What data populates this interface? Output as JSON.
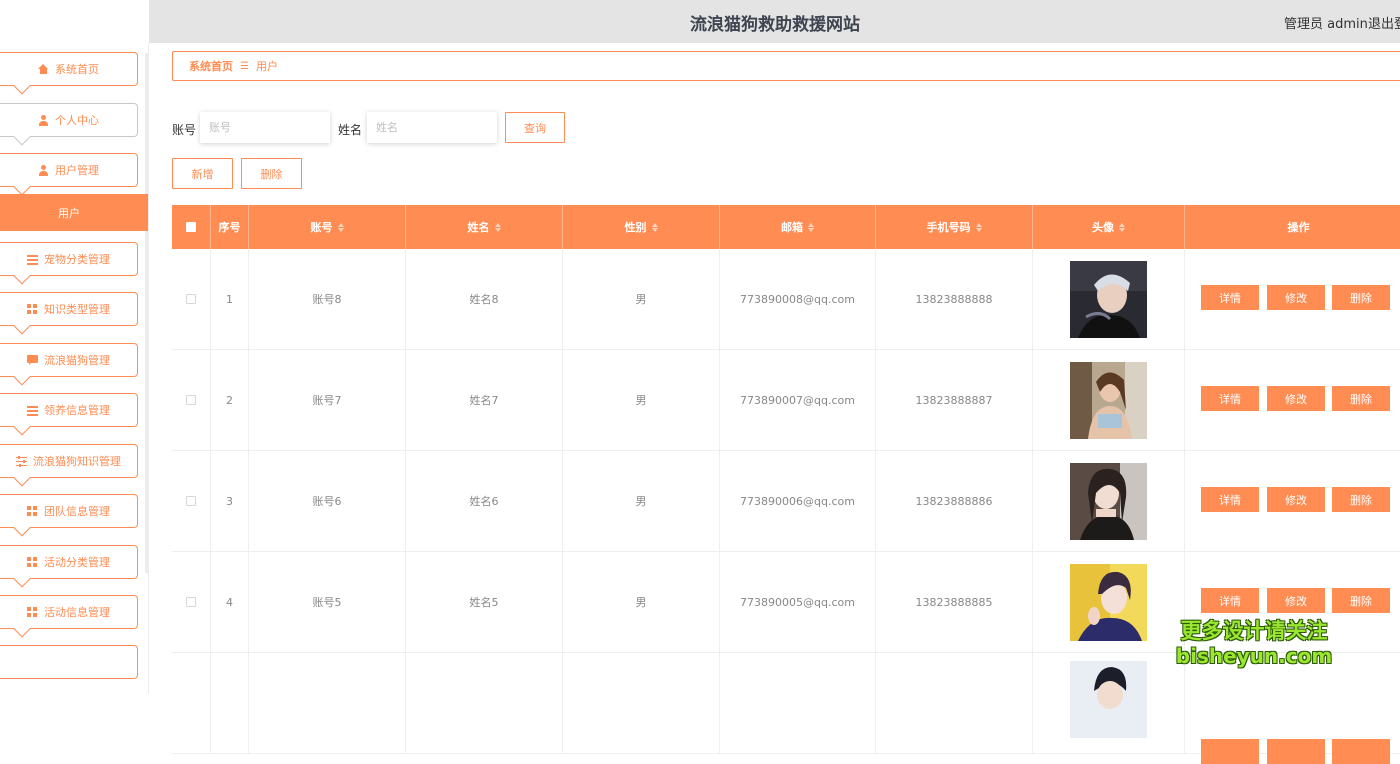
{
  "header": {
    "title": "流浪猫狗救助救援网站",
    "user": "管理员 admin",
    "logout": "退出登录"
  },
  "sidebar": {
    "items": [
      {
        "label": "系统首页",
        "icon": "home-icon"
      },
      {
        "label": "个人中心",
        "icon": "user-icon"
      },
      {
        "label": "用户管理",
        "icon": "user-icon"
      },
      {
        "label": "宠物分类管理",
        "icon": "list-icon"
      },
      {
        "label": "知识类型管理",
        "icon": "grid-icon"
      },
      {
        "label": "流浪猫狗管理",
        "icon": "chat-icon"
      },
      {
        "label": "领养信息管理",
        "icon": "list-icon"
      },
      {
        "label": "流浪猫狗知识管理",
        "icon": "sliders-icon"
      },
      {
        "label": "团队信息管理",
        "icon": "grid-icon"
      },
      {
        "label": "活动分类管理",
        "icon": "grid-icon"
      },
      {
        "label": "活动信息管理",
        "icon": "grid-icon"
      }
    ],
    "submenu_active": "用户",
    "accent": "#ff8c52"
  },
  "breadcrumb": {
    "home": "系统首页",
    "separator": "☰",
    "current": "用户"
  },
  "search": {
    "account_label": "账号",
    "account_placeholder": "账号",
    "name_label": "姓名",
    "name_placeholder": "姓名",
    "query_button": "查询"
  },
  "actions": {
    "add": "新增",
    "delete": "删除"
  },
  "table": {
    "headers": [
      "序号",
      "账号",
      "姓名",
      "性别",
      "邮箱",
      "手机号码",
      "头像",
      "操作"
    ],
    "rows": [
      {
        "index": "1",
        "account": "账号8",
        "name": "姓名8",
        "gender": "男",
        "email": "773890008@qq.com",
        "phone": "13823888888"
      },
      {
        "index": "2",
        "account": "账号7",
        "name": "姓名7",
        "gender": "男",
        "email": "773890007@qq.com",
        "phone": "13823888887"
      },
      {
        "index": "3",
        "account": "账号6",
        "name": "姓名6",
        "gender": "男",
        "email": "773890006@qq.com",
        "phone": "13823888886"
      },
      {
        "index": "4",
        "account": "账号5",
        "name": "姓名5",
        "gender": "男",
        "email": "773890005@qq.com",
        "phone": "13823888885"
      },
      {
        "index": "",
        "account": "",
        "name": "",
        "gender": "",
        "email": "",
        "phone": ""
      }
    ],
    "row_actions": {
      "detail": "详情",
      "edit": "修改",
      "delete": "删除"
    }
  },
  "watermark": {
    "line1": "更多设计请关注",
    "line2": "bisheyun.com"
  }
}
